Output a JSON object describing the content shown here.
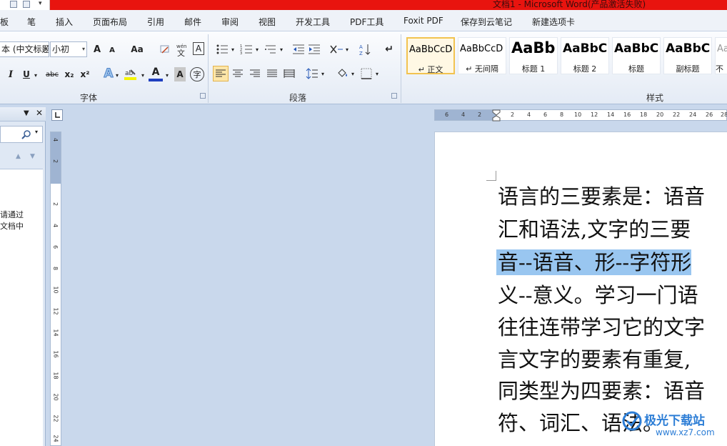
{
  "window": {
    "title": "文档1 - Microsoft Word(产品激活失败)"
  },
  "menu": {
    "tabs": [
      "板",
      "笔",
      "插入",
      "页面布局",
      "引用",
      "邮件",
      "审阅",
      "视图",
      "开发工具",
      "PDF工具",
      "Foxit PDF",
      "保存到云笔记",
      "新建选项卡"
    ]
  },
  "ribbon": {
    "font": {
      "name_value": "本 (中文标题",
      "size_value": "小初",
      "group_label": "字体",
      "grow_font": "A",
      "shrink_font": "A",
      "change_case": "Aa",
      "char_border": "A",
      "italic": "I",
      "underline": "U",
      "strikethrough": "abc",
      "subscript": "x₂",
      "superscript": "x²",
      "text_effects": "A",
      "font_color": "A",
      "char_shading": "A",
      "enclose": "字"
    },
    "paragraph": {
      "group_label": "段落"
    },
    "styles": {
      "group_label": "样式",
      "items": [
        {
          "sample": "AaBbCcD",
          "name": "↵ 正文"
        },
        {
          "sample": "AaBbCcD",
          "name": "↵ 无间隔"
        },
        {
          "sample": "AaBb",
          "name": "标题 1"
        },
        {
          "sample": "AaBbC",
          "name": "标题 2"
        },
        {
          "sample": "AaBbC",
          "name": "标题"
        },
        {
          "sample": "AaBbC",
          "name": "副标题"
        },
        {
          "sample": "Aa",
          "name": "不"
        }
      ]
    }
  },
  "nav_pane": {
    "hint_lines": [
      "请通过",
      "文档中"
    ]
  },
  "rulers": {
    "horizontal_labels": [
      "6",
      "4",
      "2",
      "2",
      "4",
      "6",
      "8",
      "10",
      "12",
      "14",
      "16",
      "18",
      "20",
      "22",
      "24",
      "26",
      "28"
    ],
    "vertical_labels": [
      "4",
      "2",
      "2",
      "4",
      "6",
      "8",
      "10",
      "12",
      "14",
      "16",
      "18",
      "20",
      "22",
      "24"
    ]
  },
  "document": {
    "lines": [
      "语言的三要素是：语音",
      "汇和语法,文字的三要",
      "音--语音、形--字符形",
      "义--意义。学习一门语",
      "往往连带学习它的文字",
      "言文字的要素有重复,",
      "同类型为四要素：语音",
      "符、词汇、语法。"
    ],
    "selected_line_index": 2
  },
  "watermark": {
    "main": "极光下载站",
    "sub": "www.xz7.com"
  }
}
